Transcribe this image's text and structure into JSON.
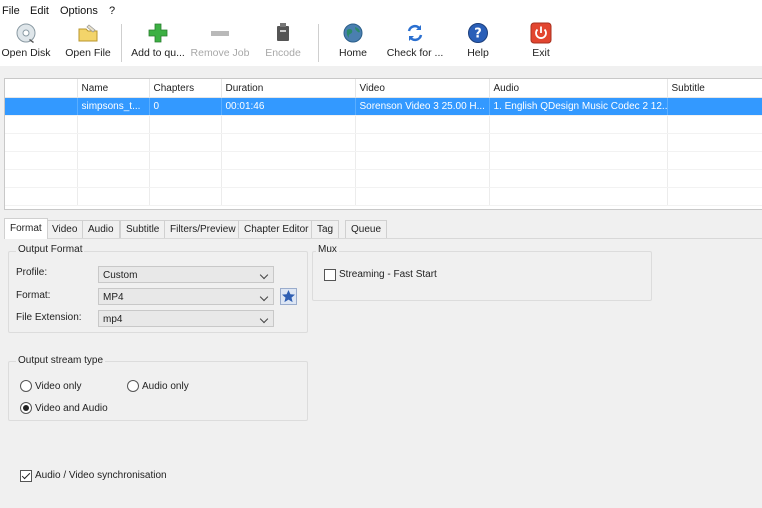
{
  "menu": [
    "File",
    "Edit",
    "Options",
    "?"
  ],
  "toolbar": {
    "open_disk": "Open Disk",
    "open_file": "Open File",
    "add_to_queue": "Add to qu...",
    "remove_job": "Remove Job",
    "encode": "Encode",
    "home": "Home",
    "check_for_updates": "Check for ...",
    "help": "Help",
    "exit": "Exit"
  },
  "file_list": {
    "columns": [
      "Name",
      "Chapters",
      "Duration",
      "Video",
      "Audio",
      "Subtitle"
    ],
    "rows": [
      [
        "simpsons_t...",
        "0",
        "00:01:46",
        "Sorenson Video 3 25.00 H...",
        "1. English QDesign Music Codec 2 12...",
        ""
      ]
    ]
  },
  "tabs": [
    "Format",
    "Video",
    "Audio",
    "Subtitle",
    "Filters/Preview",
    "Chapter Editor",
    "Tag",
    "Queue"
  ],
  "output_format": {
    "title": "Output Format",
    "profile_label": "Profile:",
    "profile_value": "Custom",
    "format_label": "Format:",
    "format_value": "MP4",
    "extension_label": "File Extension:",
    "extension_value": "mp4"
  },
  "mux": {
    "title": "Mux",
    "streaming_label": "Streaming - Fast Start",
    "streaming_checked": false
  },
  "stream_type": {
    "title": "Output stream type",
    "video_only": "Video only",
    "audio_only": "Audio only",
    "video_and_audio": "Video and Audio",
    "selected": "video_and_audio"
  },
  "sync": {
    "label": "Audio / Video synchronisation",
    "checked": true
  },
  "colors": {
    "selection": "#3399ff",
    "add_green": "#3cb043",
    "home_globe": "#2a8a6a",
    "help_blue": "#2a5fb8",
    "exit_red": "#e2452f"
  }
}
